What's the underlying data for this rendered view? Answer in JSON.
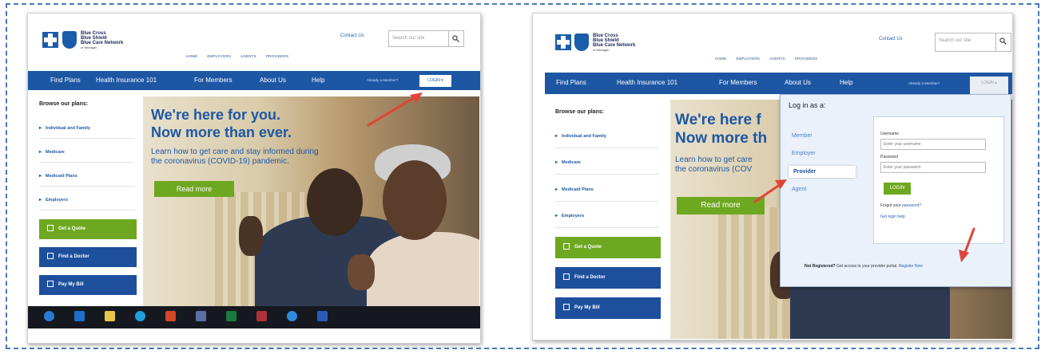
{
  "left": {
    "logo": {
      "line1": "Blue Cross",
      "line2": "Blue Shield",
      "line3": "Blue Care Network",
      "line4": "of Michigan"
    },
    "contact": "Contact Us",
    "search_placeholder": "Search our site",
    "subnav": [
      "HOME",
      "EMPLOYERS",
      "AGENTS",
      "PROVIDERS"
    ],
    "nav": [
      "Find Plans",
      "Health Insurance 101",
      "For Members",
      "About Us",
      "Help"
    ],
    "already_member": "Already a Member?",
    "login_btn": "LOGIN ▾",
    "browse_title": "Browse our plans:",
    "plans": [
      "Individual and Family",
      "Medicare",
      "Medicaid Plans",
      "Employers"
    ],
    "actions": [
      "Get a Quote",
      "Find a Doctor",
      "Pay My Bill"
    ],
    "hero_line1": "We're here for you.",
    "hero_line2": "Now more than ever.",
    "hero_sub1": "Learn how to get care and stay informed during",
    "hero_sub2": "the coronavirus (COVID-19) pandemic.",
    "read_more": "Read more"
  },
  "right": {
    "logo": {
      "line1": "Blue Cross",
      "line2": "Blue Shield",
      "line3": "Blue Care Network",
      "line4": "of Michigan"
    },
    "contact": "Contact Us",
    "search_placeholder": "Search our site",
    "subnav": [
      "HOME",
      "EMPLOYERS",
      "AGENTS",
      "PROVIDERS"
    ],
    "nav": [
      "Find Plans",
      "Health Insurance 101",
      "For Members",
      "About Us",
      "Help"
    ],
    "already_member": "Already a Member?",
    "login_btn": "LOGIN ▴",
    "browse_title": "Browse our plans:",
    "plans": [
      "Individual and Family",
      "Medicare",
      "Medicaid Plans",
      "Employers"
    ],
    "actions": [
      "Get a Quote",
      "Find a Doctor",
      "Pay My Bill"
    ],
    "hero_line1": "We're here f",
    "hero_line2": "Now more th",
    "hero_sub1": "Learn how to get care",
    "hero_sub2": "the coronavirus (COV",
    "read_more": "Read more",
    "panel": {
      "title": "Log in as a:",
      "options": [
        "Member",
        "Employer",
        "Provider",
        "Agent"
      ],
      "username_label": "Username",
      "username_placeholder": "Enter your username",
      "password_label": "Password",
      "password_placeholder": "Enter your password",
      "login": "LOGIN",
      "forgot_prefix": "Forgot your ",
      "forgot_link": "password?",
      "help": "Get login help",
      "footer_bold": "Not Registered?",
      "footer_text": " Get access to your provider portal. ",
      "footer_link": "Register Now"
    }
  },
  "colors": {
    "brand_blue": "#1d57a4",
    "accent_green": "#6ea821",
    "arrow_red": "#e0443a",
    "frame_blue": "#4a78b8"
  },
  "icons": [
    "search-icon",
    "quote-icon",
    "doctor-icon",
    "bill-icon",
    "arrow-icon"
  ]
}
